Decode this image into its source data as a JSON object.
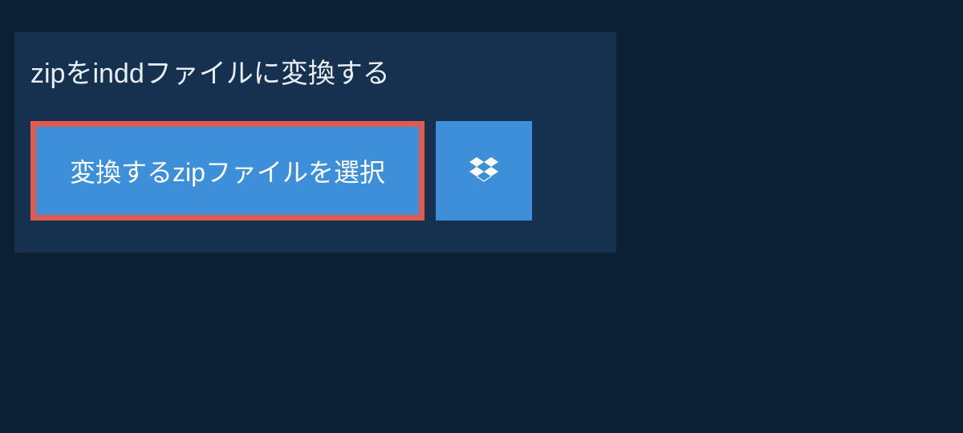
{
  "heading": "zipをinddファイルに変換する",
  "select_button_label": "変換するzipファイルを選択",
  "dropbox_icon": "dropbox"
}
